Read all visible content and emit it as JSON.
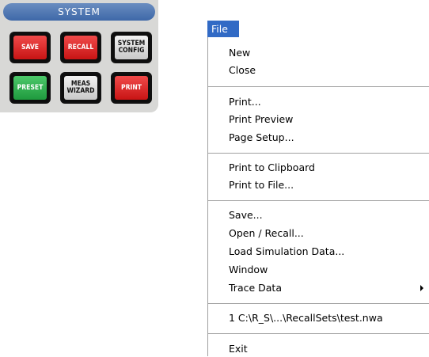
{
  "system_panel": {
    "title": "SYSTEM",
    "keys": {
      "save": "SAVE",
      "recall": "RECALL",
      "system_config": "SYSTEM\nCONFIG",
      "preset": "PRESET",
      "meas_wizard": "MEAS\nWIZARD",
      "print": "PRINT"
    }
  },
  "menu": {
    "title": "File",
    "items": {
      "new": "New",
      "close": "Close",
      "print": "Print...",
      "print_preview": "Print Preview",
      "page_setup": "Page Setup...",
      "print_clipboard": "Print to Clipboard",
      "print_file": "Print to File...",
      "save": "Save...",
      "open_recall": "Open / Recall...",
      "load_sim": "Load Simulation Data...",
      "window": "Window",
      "trace_data": "Trace Data",
      "recent_1": "1 C:\\R_S\\...\\RecallSets\\test.nwa",
      "exit": "Exit"
    }
  },
  "colors": {
    "menu_highlight": "#316ac5",
    "key_red": "#e02020",
    "key_green": "#2aaa4a",
    "key_gray": "#dcdcdc",
    "panel_bg": "#d8d8d6"
  },
  "icons": {
    "submenu": "submenu-arrow-icon"
  }
}
